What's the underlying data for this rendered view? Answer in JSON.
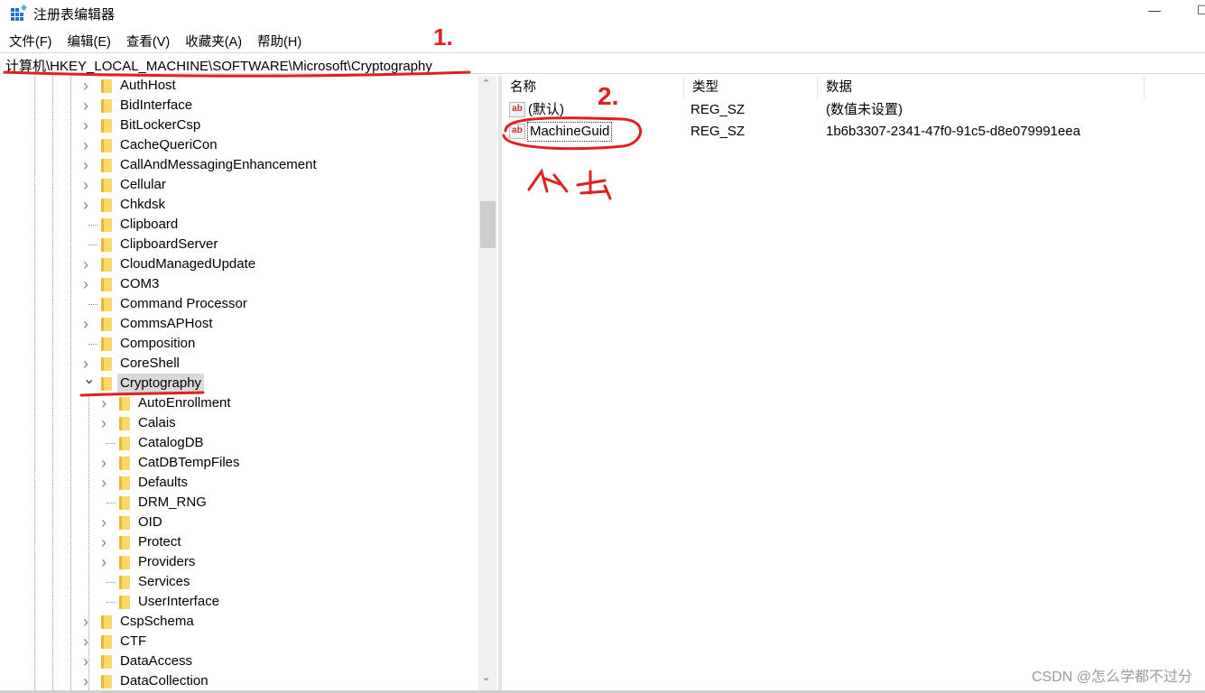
{
  "window": {
    "title": "注册表编辑器",
    "app_icon": "regedit-icon"
  },
  "menu": [
    "文件(F)",
    "编辑(E)",
    "查看(V)",
    "收藏夹(A)",
    "帮助(H)"
  ],
  "address": "计算机\\HKEY_LOCAL_MACHINE\\SOFTWARE\\Microsoft\\Cryptography",
  "tree": [
    {
      "label": "AuthHost",
      "level": 0,
      "expander": "collapsed"
    },
    {
      "label": "BidInterface",
      "level": 0,
      "expander": "collapsed"
    },
    {
      "label": "BitLockerCsp",
      "level": 0,
      "expander": "collapsed"
    },
    {
      "label": "CacheQueriCon",
      "level": 0,
      "expander": "collapsed"
    },
    {
      "label": "CallAndMessagingEnhancement",
      "level": 0,
      "expander": "collapsed"
    },
    {
      "label": "Cellular",
      "level": 0,
      "expander": "collapsed"
    },
    {
      "label": "Chkdsk",
      "level": 0,
      "expander": "collapsed"
    },
    {
      "label": "Clipboard",
      "level": 0,
      "expander": "none"
    },
    {
      "label": "ClipboardServer",
      "level": 0,
      "expander": "none"
    },
    {
      "label": "CloudManagedUpdate",
      "level": 0,
      "expander": "collapsed"
    },
    {
      "label": "COM3",
      "level": 0,
      "expander": "collapsed"
    },
    {
      "label": "Command Processor",
      "level": 0,
      "expander": "none"
    },
    {
      "label": "CommsAPHost",
      "level": 0,
      "expander": "collapsed"
    },
    {
      "label": "Composition",
      "level": 0,
      "expander": "none"
    },
    {
      "label": "CoreShell",
      "level": 0,
      "expander": "collapsed"
    },
    {
      "label": "Cryptography",
      "level": 0,
      "expander": "expanded",
      "selected": true
    },
    {
      "label": "AutoEnrollment",
      "level": 1,
      "expander": "collapsed"
    },
    {
      "label": "Calais",
      "level": 1,
      "expander": "collapsed"
    },
    {
      "label": "CatalogDB",
      "level": 1,
      "expander": "none"
    },
    {
      "label": "CatDBTempFiles",
      "level": 1,
      "expander": "collapsed"
    },
    {
      "label": "Defaults",
      "level": 1,
      "expander": "collapsed"
    },
    {
      "label": "DRM_RNG",
      "level": 1,
      "expander": "none"
    },
    {
      "label": "OID",
      "level": 1,
      "expander": "collapsed"
    },
    {
      "label": "Protect",
      "level": 1,
      "expander": "collapsed"
    },
    {
      "label": "Providers",
      "level": 1,
      "expander": "collapsed"
    },
    {
      "label": "Services",
      "level": 1,
      "expander": "none"
    },
    {
      "label": "UserInterface",
      "level": 1,
      "expander": "none"
    },
    {
      "label": "CspSchema",
      "level": 0,
      "expander": "collapsed"
    },
    {
      "label": "CTF",
      "level": 0,
      "expander": "collapsed"
    },
    {
      "label": "DataAccess",
      "level": 0,
      "expander": "collapsed"
    },
    {
      "label": "DataCollection",
      "level": 0,
      "expander": "collapsed"
    }
  ],
  "list": {
    "headers": [
      "名称",
      "类型",
      "数据"
    ],
    "rows": [
      {
        "name": "(默认)",
        "type": "REG_SZ",
        "data": "(数值未设置)"
      },
      {
        "name": "MachineGuid",
        "type": "REG_SZ",
        "data": "1b6b3307-2341-47f0-91c5-d8e079991eea",
        "focused": true
      }
    ]
  },
  "annotations": {
    "step1": "1.",
    "step2": "2.",
    "note": "双击",
    "color": "#e02020"
  },
  "watermark": "CSDN @怎么学都不过分"
}
